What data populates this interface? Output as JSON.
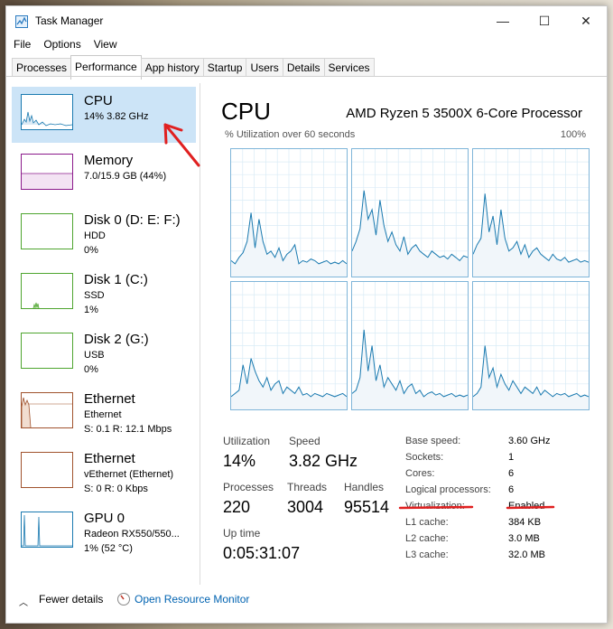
{
  "window": {
    "title": "Task Manager"
  },
  "menu": [
    "File",
    "Options",
    "View"
  ],
  "tabs": [
    "Processes",
    "Performance",
    "App history",
    "Startup",
    "Users",
    "Details",
    "Services"
  ],
  "sidebar": [
    {
      "name": "CPU",
      "sub": [
        "14% 3.82 GHz"
      ],
      "color": "#1a7ab0"
    },
    {
      "name": "Memory",
      "sub": [
        "7.0/15.9 GB (44%)"
      ],
      "color": "#8b1a8b"
    },
    {
      "name": "Disk 0 (D: E: F:)",
      "sub": [
        "HDD",
        "0%"
      ],
      "color": "#4ea52f"
    },
    {
      "name": "Disk 1 (C:)",
      "sub": [
        "SSD",
        "1%"
      ],
      "color": "#4ea52f"
    },
    {
      "name": "Disk 2 (G:)",
      "sub": [
        "USB",
        "0%"
      ],
      "color": "#4ea52f"
    },
    {
      "name": "Ethernet",
      "sub": [
        "Ethernet",
        "S: 0.1  R: 12.1 Mbps"
      ],
      "color": "#a0522d"
    },
    {
      "name": "Ethernet",
      "sub": [
        "vEthernet (Ethernet)",
        "S: 0  R: 0 Kbps"
      ],
      "color": "#a0522d"
    },
    {
      "name": "GPU 0",
      "sub": [
        "Radeon RX550/550...",
        "1% (52 °C)"
      ],
      "color": "#1a7ab0"
    }
  ],
  "main": {
    "title": "CPU",
    "model": "AMD Ryzen 5 3500X 6-Core Processor",
    "axis_left": "% Utilization over 60 seconds",
    "axis_right": "100%"
  },
  "stats": {
    "utilization_label": "Utilization",
    "utilization": "14%",
    "speed_label": "Speed",
    "speed": "3.82 GHz",
    "processes_label": "Processes",
    "processes": "220",
    "threads_label": "Threads",
    "threads": "3004",
    "handles_label": "Handles",
    "handles": "95514",
    "uptime_label": "Up time",
    "uptime": "0:05:31:07"
  },
  "right_stats": [
    {
      "label": "Base speed:",
      "value": "3.60 GHz"
    },
    {
      "label": "Sockets:",
      "value": "1"
    },
    {
      "label": "Cores:",
      "value": "6"
    },
    {
      "label": "Logical processors:",
      "value": "6"
    },
    {
      "label": "Virtualization:",
      "value": "Enabled"
    },
    {
      "label": "L1 cache:",
      "value": "384 KB"
    },
    {
      "label": "L2 cache:",
      "value": "3.0 MB"
    },
    {
      "label": "L3 cache:",
      "value": "32.0 MB"
    }
  ],
  "footer": {
    "fewer": "Fewer details",
    "monitor": "Open Resource Monitor"
  },
  "colors": {
    "cpu_line": "#1a7ab0",
    "cpu_fill": "#f1f6fa",
    "annotation": "#e02020",
    "selected": "#cce4f7",
    "link": "#0063b1"
  }
}
